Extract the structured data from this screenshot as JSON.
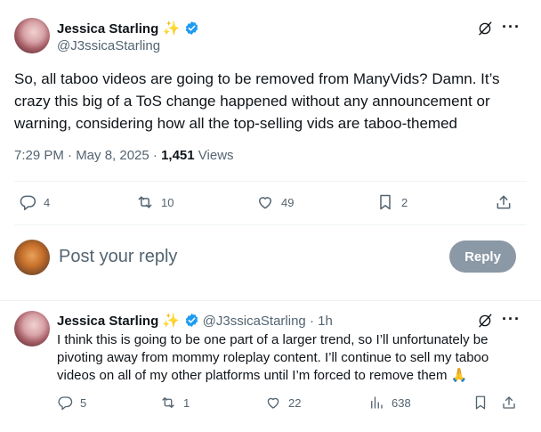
{
  "tweet": {
    "author_name": "Jessica Starling",
    "author_emoji": "✨",
    "author_handle": "@J3ssicaStarling",
    "text": "So, all taboo videos are going to be removed from ManyVids? Damn. It’s crazy this big of a ToS change happened without any announcement or warning, considering how all the top-selling vids are taboo-themed",
    "time": "7:29 PM · May 8, 2025 · ",
    "views_count": "1,451",
    "views_label": " Views",
    "replies": "4",
    "reposts": "10",
    "likes": "49",
    "bookmarks": "2"
  },
  "composer": {
    "placeholder": "Post your reply",
    "reply_button": "Reply"
  },
  "reply": {
    "author_name": "Jessica Starling",
    "author_emoji": "✨",
    "author_handle": "@J3ssicaStarling",
    "timestamp": " · 1h",
    "text": "I think this is going to be one part of a larger trend, so I’ll unfortunately be pivoting away from mommy roleplay content. I’ll continue to sell my taboo videos on all of my other platforms until I’m forced to remove them 🙏",
    "replies": "5",
    "reposts": "1",
    "likes": "22",
    "views": "638"
  },
  "colors": {
    "verified": "#1d9bf0",
    "secondary_text": "#536471",
    "reply_button_bg": "#8b98a5"
  },
  "icons": [
    "verified-badge-icon",
    "grok-icon",
    "more-icon",
    "reply-icon",
    "repost-icon",
    "like-icon",
    "bookmark-icon",
    "share-icon",
    "views-icon"
  ]
}
